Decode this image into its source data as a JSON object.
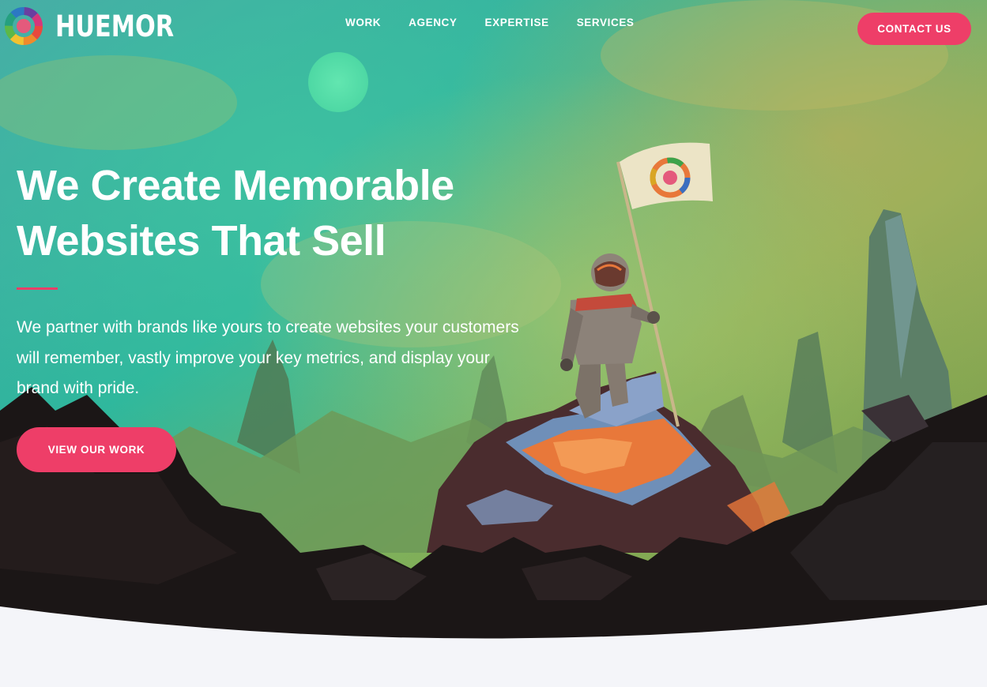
{
  "brand": {
    "name": "HUEMOR",
    "logo_icon": "color-wheel-logo-icon"
  },
  "nav": {
    "items": [
      {
        "label": "WORK"
      },
      {
        "label": "AGENCY"
      },
      {
        "label": "EXPERTISE"
      },
      {
        "label": "SERVICES"
      }
    ],
    "contact_label": "CONTACT US"
  },
  "hero": {
    "headline_line1": "We Create Memorable",
    "headline_line2": "Websites That Sell",
    "lead": "We partner with brands like yours to create websites your customers will remember, vastly improve your key metrics, and display your brand with pride.",
    "cta_label": "VIEW OUR WORK",
    "illustration": "astronaut-planting-flag-illustration"
  },
  "colors": {
    "accent": "#ee3e68",
    "sky_teal": "#2bb59c",
    "sky_green": "#7fb05a",
    "rock_dark": "#111111",
    "lava_orange": "#e8783a",
    "page_background": "#f4f5f9"
  }
}
